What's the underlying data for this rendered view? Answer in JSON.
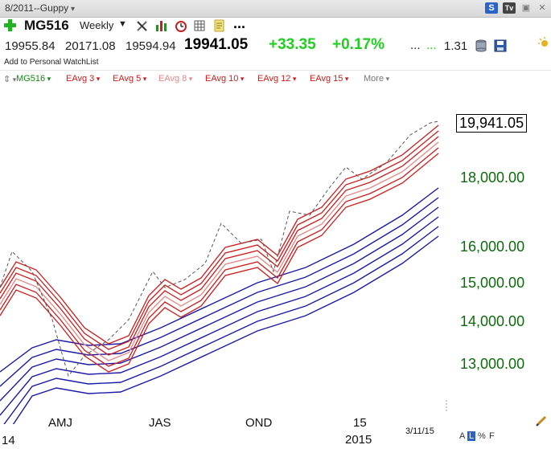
{
  "window": {
    "title": "8/2011--Guppy"
  },
  "toolbar": {
    "symbol": "MG516",
    "period": "Weekly",
    "more": "..."
  },
  "quote": {
    "open": "19955.84",
    "high": "20171.08",
    "low": "19594.94",
    "last": "19941.05",
    "change": "+33.35",
    "change_pct": "+0.17%",
    "dots1": "...",
    "dots2": "...",
    "ratio": "1.31"
  },
  "watchlist": {
    "add_label": "Add to Personal WatchList"
  },
  "legend": {
    "items": [
      {
        "label": "MG516",
        "color": "#138a13"
      },
      {
        "label": "EAvg 3",
        "color": "#d11a1a"
      },
      {
        "label": "EAvg 5",
        "color": "#d11a1a"
      },
      {
        "label": "EAvg 8",
        "color": "#e98585"
      },
      {
        "label": "EAvg 10",
        "color": "#d11a1a"
      },
      {
        "label": "EAvg 12",
        "color": "#d11a1a"
      },
      {
        "label": "EAvg 15",
        "color": "#d11a1a"
      },
      {
        "label": "More",
        "color": "#777777"
      }
    ]
  },
  "chart": {
    "last_price_label": "19,941.05",
    "y_labels": [
      {
        "label": "18,000.00",
        "value": 18000
      },
      {
        "label": "16,000.00",
        "value": 16000
      },
      {
        "label": "15,000.00",
        "value": 15000
      },
      {
        "label": "14,000.00",
        "value": 14000
      },
      {
        "label": "13,000.00",
        "value": 13000
      }
    ],
    "x_labels": [
      {
        "label": "AMJ"
      },
      {
        "label": "JAS"
      },
      {
        "label": "OND"
      },
      {
        "label": "15"
      },
      {
        "label": "2015"
      }
    ],
    "left_year_fragment": "14",
    "date": "3/11/15",
    "scale_options": [
      "A",
      "L",
      "%",
      "F"
    ],
    "selected_scale": "L",
    "colors": {
      "price": "#555555",
      "short_ma": "#d11a1a",
      "short_ma_light": "#e98585",
      "long_ma": "#1a1aaa",
      "axis_label": "#0b6b0b"
    }
  }
}
